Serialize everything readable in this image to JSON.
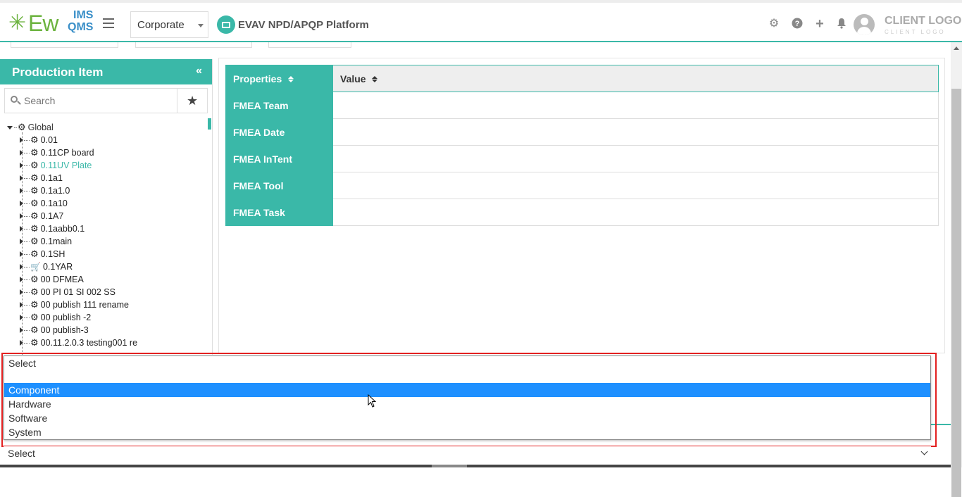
{
  "header": {
    "logo_text": "Ew",
    "logo_ims": "IMS",
    "logo_qms": "QMS",
    "company_select": "Corporate",
    "platform_title": "EVAV NPD/APQP Platform",
    "client_logo": "CLIENT LOGO",
    "client_logo_sub": "CLIENT LOGO"
  },
  "left_panel": {
    "title": "Production Item",
    "search_placeholder": "Search",
    "tree_root": "Global",
    "tree_items": [
      {
        "label": "0.01",
        "icon": "gear-icon"
      },
      {
        "label": "0.11CP board",
        "icon": "gear-icon"
      },
      {
        "label": "0.11UV Plate",
        "icon": "gear-icon",
        "active": true
      },
      {
        "label": "0.1a1",
        "icon": "gear-icon"
      },
      {
        "label": "0.1a1.0",
        "icon": "gear-icon"
      },
      {
        "label": "0.1a10",
        "icon": "gear-icon"
      },
      {
        "label": "0.1A7",
        "icon": "gear-icon"
      },
      {
        "label": "0.1aabb0.1",
        "icon": "gear-icon"
      },
      {
        "label": "0.1main",
        "icon": "gear-icon"
      },
      {
        "label": "0.1SH",
        "icon": "gear-icon"
      },
      {
        "label": "0.1YAR",
        "icon": "cart-icon"
      },
      {
        "label": "00 DFMEA",
        "icon": "gear-icon"
      },
      {
        "label": "00 PI 01 SI 002 SS",
        "icon": "gear-icon"
      },
      {
        "label": "00 publish 111 rename",
        "icon": "gear-icon"
      },
      {
        "label": "00 publish -2",
        "icon": "gear-icon"
      },
      {
        "label": "00 publish-3",
        "icon": "gear-icon"
      },
      {
        "label": "00.11.2.0.3 testing001 re",
        "icon": "gear-icon"
      }
    ]
  },
  "properties": {
    "col_properties": "Properties",
    "col_value": "Value",
    "rows": [
      {
        "key": "FMEA Team",
        "value": ""
      },
      {
        "key": "FMEA Date",
        "value": ""
      },
      {
        "key": "FMEA InTent",
        "value": ""
      },
      {
        "key": "FMEA Tool",
        "value": ""
      },
      {
        "key": "FMEA Task",
        "value": ""
      }
    ]
  },
  "dropdown": {
    "options": [
      "Select",
      "",
      "Component",
      "Hardware",
      "Software",
      "System"
    ],
    "highlighted": "Component",
    "current_value": "Select"
  },
  "colors": {
    "accent": "#3ab8a8",
    "selection": "#1e90ff",
    "highlight_border": "#e32020"
  }
}
